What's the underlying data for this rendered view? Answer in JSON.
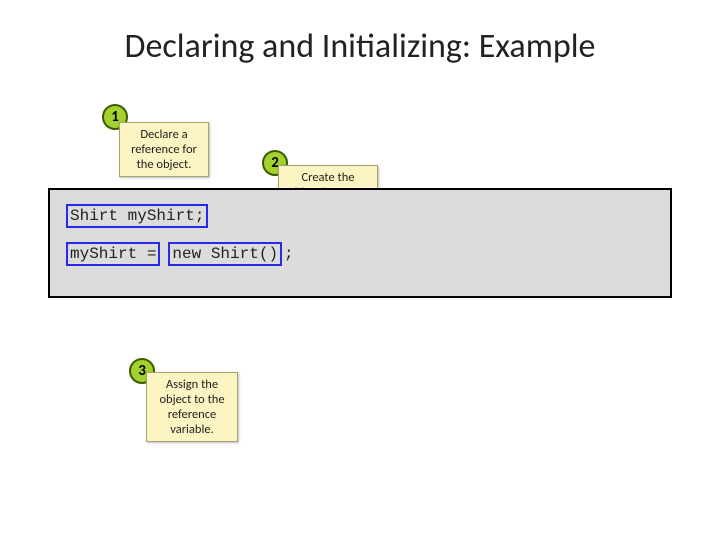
{
  "title": "Declaring and Initializing: Example",
  "callouts": {
    "one": {
      "num": "1",
      "text": "Declare a reference for the object."
    },
    "two": {
      "num": "2",
      "text": "Create the object instance."
    },
    "three": {
      "num": "3",
      "text": "Assign the object to the reference variable."
    }
  },
  "code": {
    "line1": "Shirt myShirt;",
    "line2_left": "myShirt =",
    "line2_right": "new Shirt()",
    "line2_tail": ";"
  }
}
